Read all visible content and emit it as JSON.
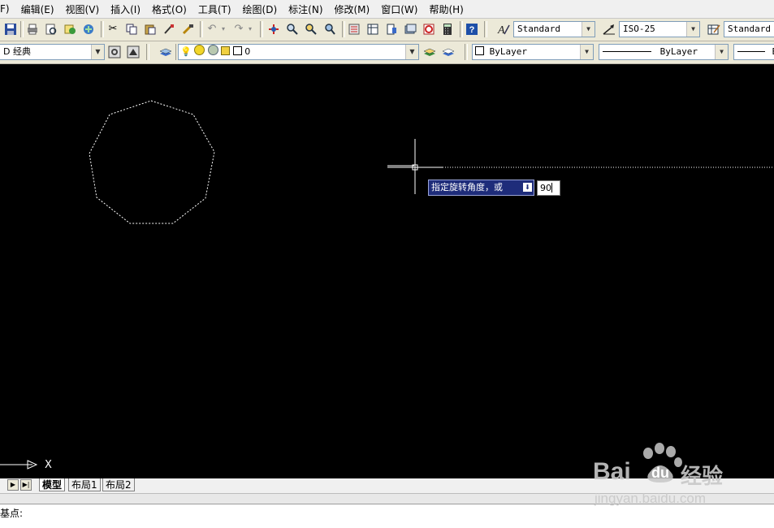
{
  "menu": [
    "F)",
    "编辑(E)",
    "视图(V)",
    "插入(I)",
    "格式(O)",
    "工具(T)",
    "绘图(D)",
    "标注(N)",
    "修改(M)",
    "窗口(W)",
    "帮助(H)"
  ],
  "toolbar": {
    "text_style": "Standard",
    "dim_style": "ISO-25",
    "table_style": "Standard",
    "workspace": "D 经典",
    "layer": "0",
    "color": "ByLayer",
    "linetype": "ByLayer",
    "lineweight": "B"
  },
  "canvas": {
    "tooltip_prompt": "指定旋转角度，或",
    "angle_input": "90",
    "axis_label": "X"
  },
  "tabs": {
    "model": "模型",
    "layout1": "布局1",
    "layout2": "布局2"
  },
  "command_line": "基点:",
  "watermark": {
    "brand": "Bai",
    "brand2": "du",
    "product": "经验",
    "url": "jingyan.baidu.com"
  },
  "icons": [
    "save-icon",
    "print-icon",
    "plot-preview-icon",
    "publish-icon",
    "etransmit-icon",
    "cut-icon",
    "copy-icon",
    "paste-icon",
    "matchprop-icon",
    "brush-icon",
    "undo-icon",
    "redo-icon",
    "pan-icon",
    "zoom-realtime-icon",
    "zoom-window-icon",
    "zoom-previous-icon",
    "properties-icon",
    "designcenter-icon",
    "toolpalettes-icon",
    "sheetset-icon",
    "markup-icon",
    "calculator-icon",
    "help-icon"
  ]
}
